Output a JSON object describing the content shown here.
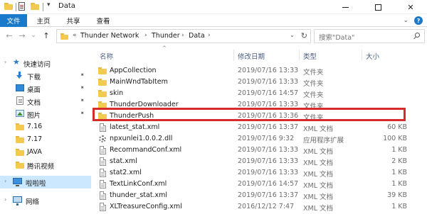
{
  "window": {
    "title": "Data",
    "minimize_glyph": "",
    "close_glyph": "✕"
  },
  "quick_access_toolbar": {
    "pin_glyph": "▾"
  },
  "ribbon": {
    "tabs": [
      "文件",
      "主页",
      "共享",
      "查看"
    ],
    "expand_glyph": "⌄",
    "help_glyph": "?"
  },
  "navigation": {
    "back_glyph": "←",
    "forward_glyph": "→",
    "recent_glyph": "⌄",
    "up_glyph": "↑"
  },
  "address_bar": {
    "overflow": "«",
    "separator": "›",
    "breadcrumbs": [
      "Thunder Network",
      "Thunder",
      "Data"
    ],
    "dropdown_glyph": "⌄",
    "refresh_glyph": "↻"
  },
  "search": {
    "placeholder": "搜索\"Data\""
  },
  "nav_pane": {
    "quick_access": "快速访问",
    "items": [
      {
        "label": "下载",
        "icon": "download-icon",
        "pinned": true
      },
      {
        "label": "桌面",
        "icon": "desktop-icon",
        "pinned": true
      },
      {
        "label": "文档",
        "icon": "documents-icon",
        "pinned": true
      },
      {
        "label": "图片",
        "icon": "pictures-icon",
        "pinned": true
      },
      {
        "label": "7.16",
        "icon": "folder-icon",
        "pinned": false
      },
      {
        "label": "7.17",
        "icon": "folder-icon",
        "pinned": false
      },
      {
        "label": "JAVA",
        "icon": "folder-icon",
        "pinned": false
      },
      {
        "label": "腾讯视频",
        "icon": "folder-icon",
        "pinned": false
      }
    ],
    "this_pc": "啦啦啦",
    "network": "网络",
    "expand_glyph": "›",
    "pin_glyph": "📌"
  },
  "file_list": {
    "sort_glyph": "^",
    "columns": {
      "name": "名称",
      "date": "修改日期",
      "type": "类型",
      "size": "大小"
    },
    "rows": [
      {
        "name": "AppCollection",
        "date": "2019/07/16 13:33",
        "type": "文件夹",
        "size": "",
        "icon": "folder-icon"
      },
      {
        "name": "MainWndTabItem",
        "date": "2019/07/16 13:33",
        "type": "文件夹",
        "size": "",
        "icon": "folder-icon"
      },
      {
        "name": "skin",
        "date": "2019/07/16 14:57",
        "type": "文件夹",
        "size": "",
        "icon": "folder-icon"
      },
      {
        "name": "ThunderDownloader",
        "date": "2019/07/16 13:33",
        "type": "文件夹",
        "size": "",
        "icon": "folder-icon"
      },
      {
        "name": "ThunderPush",
        "date": "2019/07/16 13:36",
        "type": "文件夹",
        "size": "",
        "icon": "folder-icon"
      },
      {
        "name": "latest_stat.xml",
        "date": "2019/07/16 13:37",
        "type": "XML 文档",
        "size": "60 KB",
        "icon": "xml-file-icon"
      },
      {
        "name": "npxunlei1.0.0.2.dll",
        "date": "2019/07/16 9:32",
        "type": "应用程序扩展",
        "size": "100 KB",
        "icon": "dll-file-icon"
      },
      {
        "name": "RecommandConf.xml",
        "date": "2019/07/16 13:33",
        "type": "XML 文档",
        "size": "1 KB",
        "icon": "xml-file-icon"
      },
      {
        "name": "stat.xml",
        "date": "2019/07/16 13:33",
        "type": "XML 文档",
        "size": "2 KB",
        "icon": "xml-file-icon"
      },
      {
        "name": "stat2.xml",
        "date": "2019/07/16 13:33",
        "type": "XML 文档",
        "size": "1 KB",
        "icon": "xml-file-icon"
      },
      {
        "name": "TextLinkConf.xml",
        "date": "2019/07/16 14:57",
        "type": "XML 文档",
        "size": "1 KB",
        "icon": "xml-file-icon"
      },
      {
        "name": "thunder_stat.xml",
        "date": "2019/07/16 13:37",
        "type": "XML 文档",
        "size": "39 KB",
        "icon": "xml-file-icon"
      },
      {
        "name": "XLTreasureConfig.xml",
        "date": "2016/12/12 7:47",
        "type": "XML 文档",
        "size": "1 KB",
        "icon": "xml-file-icon"
      }
    ]
  },
  "colors": {
    "accent": "#1979ca",
    "highlight_border": "#d62b2b",
    "selected_nav_bg": "#cce8ff",
    "folder": "#f4c94f"
  }
}
